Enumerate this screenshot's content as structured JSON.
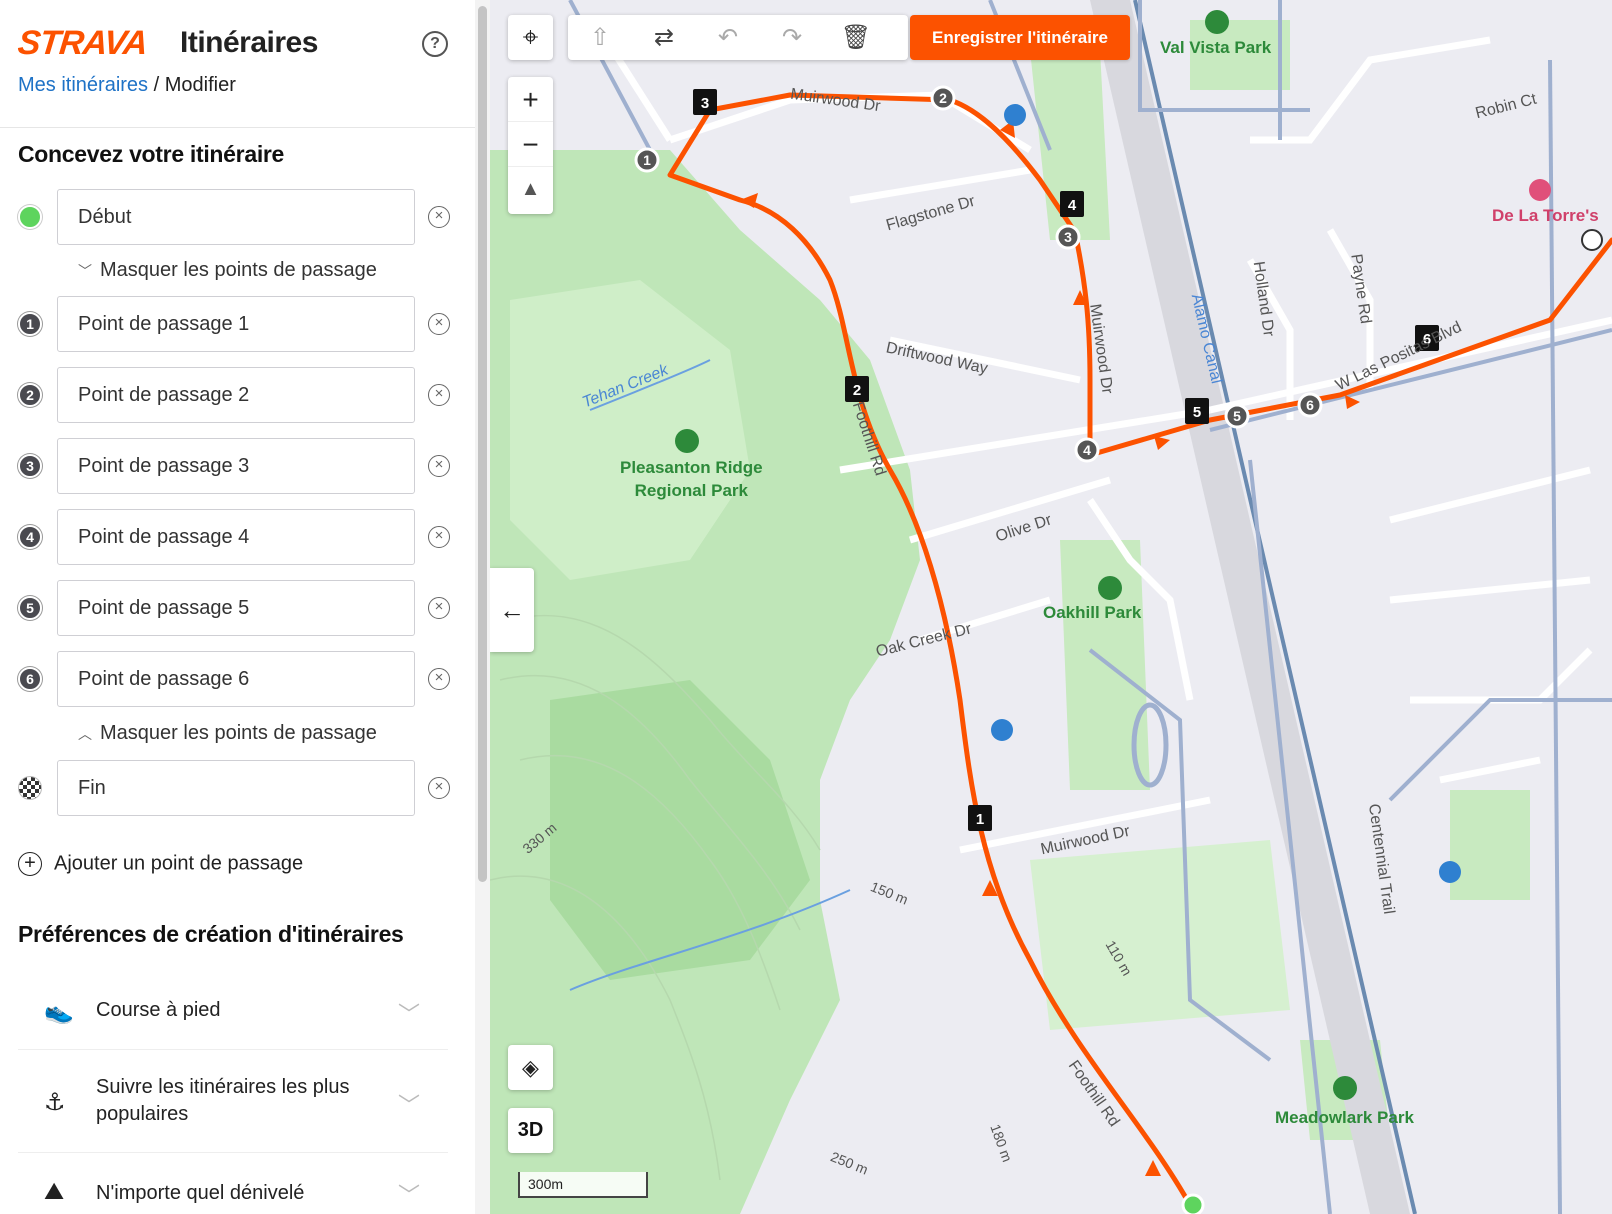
{
  "header": {
    "logo": "STRAVA",
    "title": "Itinéraires",
    "help": "?",
    "breadcrumb_link": "Mes itinéraires",
    "breadcrumb_sep": " / ",
    "breadcrumb_current": "Modifier"
  },
  "design": {
    "title": "Concevez votre itinéraire",
    "start": "Début",
    "toggle_hide_1": "Masquer les points de passage",
    "waypoints": [
      {
        "num": "1",
        "label": "Point de passage 1"
      },
      {
        "num": "2",
        "label": "Point de passage 2"
      },
      {
        "num": "3",
        "label": "Point de passage 3"
      },
      {
        "num": "4",
        "label": "Point de passage 4"
      },
      {
        "num": "5",
        "label": "Point de passage 5"
      },
      {
        "num": "6",
        "label": "Point de passage 6"
      }
    ],
    "toggle_hide_2": "Masquer les points de passage",
    "end": "Fin",
    "add_waypoint": "Ajouter un point de passage"
  },
  "preferences": {
    "title": "Préférences de création d'itinéraires",
    "items": [
      {
        "label": "Course à pied",
        "icon": "running-shoe-icon"
      },
      {
        "label": "Suivre les itinéraires les plus populaires",
        "icon": "popularity-icon"
      },
      {
        "label": "N'importe quel dénivelé",
        "icon": "elevation-icon"
      }
    ]
  },
  "map": {
    "save_button": "Enregistrer l'itinéraire",
    "three_d": "3D",
    "scale": "300m",
    "route_color": "#fc5200",
    "labels": {
      "muirwood_top": "Muirwood Dr",
      "flagstone": "Flagstone Dr",
      "driftwood": "Driftwood Way",
      "tehan": "Tehan Creek",
      "foothill": "Foothill Rd",
      "muirwood_right": "Muirwood Dr",
      "alamo": "Alamo Canal",
      "holland": "Holland Dr",
      "payne": "Payne Rd",
      "las_positas": "W Las Positas Blvd",
      "olive": "Olive Dr",
      "oak_creek": "Oak Creek Dr",
      "muirwood_bottom": "Muirwood Dr",
      "centennial": "Centennial Trail",
      "foothill_bottom": "Foothill Rd",
      "robin": "Robin Ct",
      "e330": "330 m",
      "e150": "150 m",
      "e110": "110 m",
      "e250": "250 m",
      "e180": "180 m"
    },
    "parks": {
      "val_vista": "Val Vista Park",
      "pleasanton": "Pleasanton Ridge\nRegional Park",
      "oakhill": "Oakhill Park",
      "meadowlark": "Meadowlark Park",
      "de_la_torre": "De La Torre's"
    },
    "route_markers": [
      "1",
      "2",
      "3",
      "4",
      "5",
      "6"
    ]
  }
}
